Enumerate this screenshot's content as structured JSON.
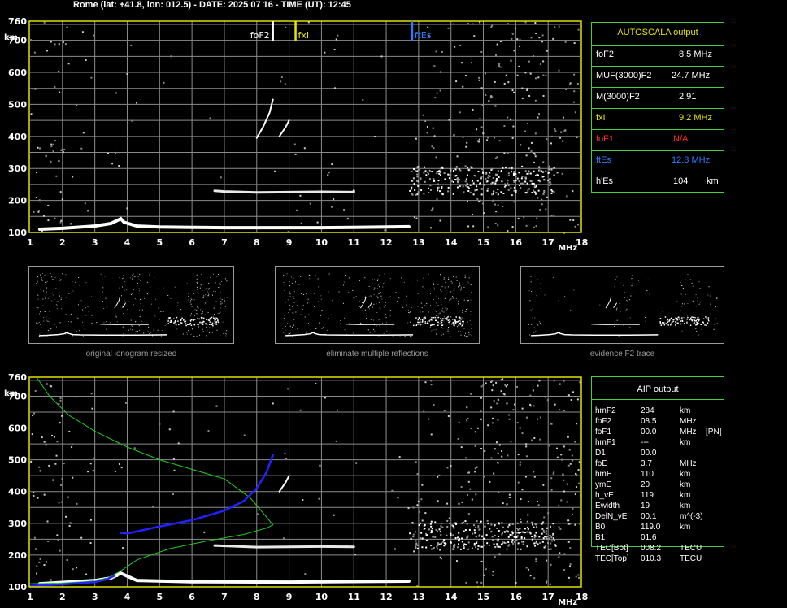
{
  "header": {
    "title": "Rome (lat: +41.8, lon: 012.5) - DATE: 2025 07 16 - TIME (UT): 12:45"
  },
  "colors": {
    "grid": "#8c8c8c",
    "frame": "#e0e000",
    "table_border": "#3bd23b",
    "fof2": "#ffffff",
    "fxi": "#e6e600",
    "ftes": "#2f7bff",
    "fof1": "#ff2a2a",
    "profile": "#22cc22",
    "profile_blue": "#2222ff"
  },
  "chart_data": [
    {
      "type": "scatter",
      "name": "ionogram-autoscala",
      "x_unit": "MHz",
      "y_unit": "km",
      "xlim": [
        1,
        18
      ],
      "ylim": [
        100,
        760
      ],
      "x_ticks": [
        "1",
        "2",
        "3",
        "4",
        "5",
        "6",
        "7",
        "8",
        "9",
        "10",
        "11",
        "12",
        "13",
        "14",
        "15",
        "16",
        "17",
        "18"
      ],
      "y_ticks": [
        "100",
        "200",
        "300",
        "400",
        "500",
        "600",
        "700",
        "760"
      ],
      "grid": true,
      "markers": [
        {
          "label": "foF2",
          "x": 8.5
        },
        {
          "label": "fxI",
          "x": 9.2
        },
        {
          "label": "ftEs",
          "x": 12.8
        }
      ],
      "traces": {
        "E_layer": [
          [
            1.3,
            110
          ],
          [
            2.0,
            113
          ],
          [
            3.0,
            120
          ],
          [
            3.5,
            128
          ],
          [
            3.7,
            138
          ],
          [
            3.8,
            143
          ],
          [
            3.9,
            132
          ],
          [
            4.3,
            120
          ],
          [
            5,
            117
          ],
          [
            6,
            116
          ],
          [
            7,
            115
          ],
          [
            8,
            115
          ],
          [
            9,
            115
          ],
          [
            10,
            115
          ],
          [
            11,
            116
          ],
          [
            12,
            117
          ],
          [
            12.7,
            118
          ]
        ],
        "Es_layer": [
          [
            6.7,
            230
          ],
          [
            7,
            228
          ],
          [
            8,
            225
          ],
          [
            9,
            226
          ],
          [
            10,
            227
          ],
          [
            11,
            226
          ],
          [
            11.0,
            230
          ]
        ],
        "F2_trace": [
          [
            8.0,
            395
          ],
          [
            8.2,
            430
          ],
          [
            8.4,
            475
          ],
          [
            8.5,
            515
          ]
        ],
        "F2_x": [
          [
            8.7,
            400
          ],
          [
            8.9,
            430
          ],
          [
            9.0,
            450
          ]
        ]
      }
    },
    {
      "type": "line",
      "name": "ionogram-aip",
      "x_unit": "MHz",
      "y_unit": "km",
      "xlim": [
        1,
        18
      ],
      "ylim": [
        100,
        760
      ],
      "x_ticks": [
        "1",
        "2",
        "3",
        "4",
        "5",
        "6",
        "7",
        "8",
        "9",
        "10",
        "11",
        "12",
        "13",
        "14",
        "15",
        "16",
        "17",
        "18"
      ],
      "y_ticks": [
        "100",
        "200",
        "300",
        "400",
        "500",
        "600",
        "700",
        "760"
      ],
      "grid": true,
      "series": [
        {
          "color": "green",
          "points": [
            [
              1.2,
              760
            ],
            [
              1.6,
              700
            ],
            [
              2.2,
              640
            ],
            [
              3,
              590
            ],
            [
              4,
              540
            ],
            [
              5,
              500
            ],
            [
              6,
              470
            ],
            [
              7,
              440
            ],
            [
              7.8,
              380
            ],
            [
              8.3,
              320
            ],
            [
              8.5,
              295
            ],
            [
              8.3,
              285
            ],
            [
              7.6,
              265
            ],
            [
              6.5,
              245
            ],
            [
              5.3,
              220
            ],
            [
              4.3,
              185
            ],
            [
              3.8,
              150
            ],
            [
              3.4,
              128
            ],
            [
              2.8,
              117
            ],
            [
              2,
              112
            ],
            [
              1,
              110
            ]
          ]
        },
        {
          "color": "blue",
          "points": [
            [
              3.8,
              270
            ],
            [
              4,
              268
            ],
            [
              5,
              290
            ],
            [
              6,
              310
            ],
            [
              7,
              340
            ],
            [
              7.6,
              370
            ],
            [
              8.0,
              410
            ],
            [
              8.3,
              460
            ],
            [
              8.5,
              515
            ]
          ]
        },
        {
          "color": "blue",
          "points": [
            [
              1,
              103
            ],
            [
              2,
              108
            ],
            [
              3,
              115
            ],
            [
              3.4,
              125
            ],
            [
              3.6,
              135
            ]
          ]
        }
      ],
      "traces": {
        "E_layer": [
          [
            1.3,
            110
          ],
          [
            3.0,
            120
          ],
          [
            3.5,
            128
          ],
          [
            3.8,
            143
          ],
          [
            4.3,
            120
          ],
          [
            6,
            116
          ],
          [
            9,
            115
          ],
          [
            12.7,
            118
          ]
        ],
        "Es_layer": [
          [
            6.7,
            230
          ],
          [
            8,
            225
          ],
          [
            10,
            227
          ],
          [
            11,
            226
          ]
        ],
        "F2_x": [
          [
            8.7,
            400
          ],
          [
            8.9,
            430
          ],
          [
            9.0,
            450
          ]
        ]
      }
    }
  ],
  "autoscala": {
    "title": "AUTOSCALA output",
    "rows": [
      {
        "label": "foF2",
        "value": "8.5 MHz"
      },
      {
        "label": "MUF(3000)F2",
        "value": "24.7 MHz"
      },
      {
        "label": "M(3000)F2",
        "value": "2.91"
      },
      {
        "label": "fxI",
        "value": "9.2 MHz"
      },
      {
        "label": "foF1",
        "value": "N/A"
      },
      {
        "label": "ftEs",
        "value": "12.8 MHz"
      },
      {
        "label": "h'Es",
        "value": "104",
        "unit": "km"
      }
    ]
  },
  "aip": {
    "title": "AIP output",
    "rows": [
      {
        "k": "hmF2",
        "v": "284",
        "u": "km",
        "x": ""
      },
      {
        "k": "foF2",
        "v": "08.5",
        "u": "MHz",
        "x": ""
      },
      {
        "k": "foF1",
        "v": "00.0",
        "u": "MHz",
        "x": "[PN]"
      },
      {
        "k": "hmF1",
        "v": "---",
        "u": "km",
        "x": ""
      },
      {
        "k": "D1",
        "v": "00.0",
        "u": "",
        "x": ""
      },
      {
        "k": "foE",
        "v": "3.7",
        "u": "MHz",
        "x": ""
      },
      {
        "k": "hmE",
        "v": "110",
        "u": "km",
        "x": ""
      },
      {
        "k": "ymE",
        "v": "20",
        "u": "km",
        "x": ""
      },
      {
        "k": "h_vE",
        "v": "119",
        "u": "km",
        "x": ""
      },
      {
        "k": "Ewidth",
        "v": "19",
        "u": "km",
        "x": ""
      },
      {
        "k": "DelN_vE",
        "v": "00.1",
        "u": "m^(-3)",
        "x": ""
      },
      {
        "k": "B0",
        "v": "119.0",
        "u": "km",
        "x": ""
      },
      {
        "k": "B1",
        "v": "01.6",
        "u": "",
        "x": ""
      },
      {
        "k": "TEC[Bot]",
        "v": "008.2",
        "u": "TECU",
        "x": ""
      },
      {
        "k": "TEC[Top]",
        "v": "010.3",
        "u": "TECU",
        "x": ""
      }
    ]
  },
  "thumbnails": [
    {
      "caption": "original ionogram resized"
    },
    {
      "caption": "eliminate multiple reflections"
    },
    {
      "caption": "evidence F2 trace"
    }
  ],
  "axis_labels": {
    "km": "km",
    "mhz": "MHz"
  }
}
